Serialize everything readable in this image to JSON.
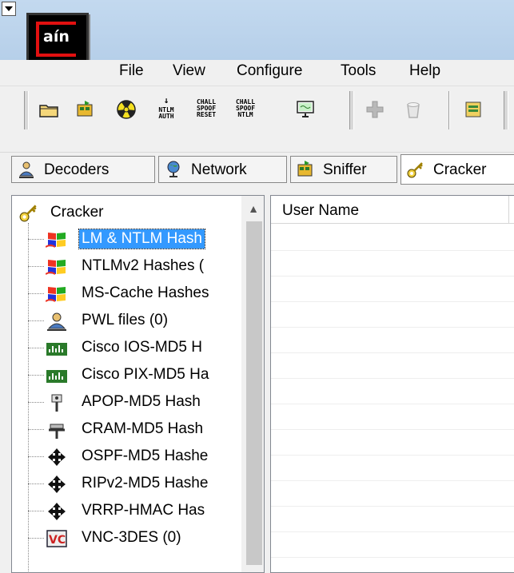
{
  "app": {
    "logo_text": "aín"
  },
  "menu": [
    "File",
    "View",
    "Configure",
    "Tools",
    "Help"
  ],
  "toolbar": {
    "ntlm_auth": "NTLM AUTH",
    "chall_spoof_reset": "CHALL SPOOF RESET",
    "chall_spoof_ntlm": "CHALL SPOOF NTLM"
  },
  "tabs": [
    {
      "label": "Decoders",
      "icon": "decoders-icon"
    },
    {
      "label": "Network",
      "icon": "network-globe-icon"
    },
    {
      "label": "Sniffer",
      "icon": "sniffer-icon"
    },
    {
      "label": "Cracker",
      "icon": "key-icon"
    }
  ],
  "tree": {
    "root": "Cracker",
    "items": [
      {
        "label": "LM & NTLM Hash",
        "icon": "windows-flag-icon",
        "selected": true
      },
      {
        "label": "NTLMv2 Hashes (",
        "icon": "windows-flag-icon"
      },
      {
        "label": "MS-Cache Hashes",
        "icon": "windows-flag-icon"
      },
      {
        "label": "PWL files (0)",
        "icon": "pwl-icon"
      },
      {
        "label": "Cisco IOS-MD5 H",
        "icon": "cisco-icon"
      },
      {
        "label": "Cisco PIX-MD5 Ha",
        "icon": "cisco-icon"
      },
      {
        "label": "APOP-MD5 Hash",
        "icon": "apop-icon"
      },
      {
        "label": "CRAM-MD5 Hash",
        "icon": "cram-icon"
      },
      {
        "label": "OSPF-MD5 Hashe",
        "icon": "cross-arrows-icon"
      },
      {
        "label": "RIPv2-MD5 Hashe",
        "icon": "cross-arrows-icon"
      },
      {
        "label": "VRRP-HMAC Has",
        "icon": "cross-arrows-icon"
      },
      {
        "label": "VNC-3DES (0)",
        "icon": "vnc-icon"
      }
    ]
  },
  "list": {
    "columns": [
      "User Name"
    ]
  },
  "colors": {
    "selection": "#3399ff",
    "logo_red": "#e21010"
  }
}
